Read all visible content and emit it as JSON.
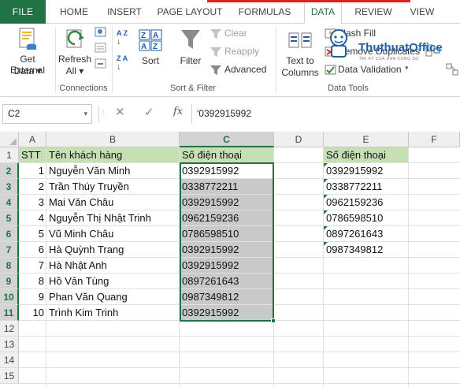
{
  "tabs": [
    {
      "label": "FILE"
    },
    {
      "label": "HOME"
    },
    {
      "label": "INSERT"
    },
    {
      "label": "PAGE LAYOUT"
    },
    {
      "label": "FORMULAS"
    },
    {
      "label": "DATA"
    },
    {
      "label": "REVIEW"
    },
    {
      "label": "VIEW"
    }
  ],
  "active_tab": "DATA",
  "ribbon": {
    "get_external_data": {
      "line1": "Get External",
      "line2": "Data ▾"
    },
    "refresh_all": {
      "line1": "Refresh",
      "line2": "All ▾"
    },
    "connections_label": "Connections",
    "sort": "Sort",
    "filter": "Filter",
    "clear": "Clear",
    "reapply": "Reapply",
    "advanced": "Advanced",
    "sort_filter_label": "Sort & Filter",
    "text_to_columns": {
      "line1": "Text to",
      "line2": "Columns"
    },
    "flash_fill": "Flash Fill",
    "remove_duplicates": "Remove Duplicates",
    "data_validation": "Data Validation",
    "data_tools_label": "Data Tools",
    "sort_az": "A Z",
    "sort_za": "Z A"
  },
  "formula_bar": {
    "name_box": "C2",
    "cancel": "✕",
    "enter": "✓",
    "fx": "fx",
    "value": "'0392915992"
  },
  "columns": [
    "A",
    "B",
    "C",
    "D",
    "E",
    "F"
  ],
  "selected_column": "C",
  "rows": [
    "1",
    "2",
    "3",
    "4",
    "5",
    "6",
    "7",
    "8",
    "9",
    "10",
    "11",
    "12",
    "13",
    "14",
    "15"
  ],
  "headers": {
    "stt": "STT",
    "ten": "Tên khách hàng",
    "sdt": "Số điện thoại",
    "sdt_e": "Số điện thoại"
  },
  "data_rows": [
    {
      "stt": "1",
      "name": "Nguyễn Văn Minh",
      "phone": "0392915992"
    },
    {
      "stt": "2",
      "name": "Trần Thúy Truyền",
      "phone": "0338772211"
    },
    {
      "stt": "3",
      "name": "Mai Văn Châu",
      "phone": "0392915992"
    },
    {
      "stt": "4",
      "name": "Nguyễn Thị Nhật Trinh",
      "phone": "0962159236"
    },
    {
      "stt": "5",
      "name": "Vũ Minh Châu",
      "phone": "0786598510"
    },
    {
      "stt": "6",
      "name": "Hà Quỳnh Trang",
      "phone": "0392915992"
    },
    {
      "stt": "7",
      "name": "Hà Nhật Anh",
      "phone": "0392915992"
    },
    {
      "stt": "8",
      "name": "Hồ Văn Tùng",
      "phone": "0897261643"
    },
    {
      "stt": "9",
      "name": "Phan Văn Quang",
      "phone": "0987349812"
    },
    {
      "stt": "10",
      "name": "Trình Kim Trinh",
      "phone": "0392915992"
    }
  ],
  "unique_phones": [
    "0392915992",
    "0338772211",
    "0962159236",
    "0786598510",
    "0897261643",
    "0987349812"
  ],
  "watermark": {
    "title": "ThuthuatOffice",
    "subtitle": "TRI KY CUA DAN CONG SO"
  },
  "colors": {
    "excel_green": "#217346",
    "header_fill": "#c6e0b4",
    "selection_fill": "#c9c9c9"
  }
}
